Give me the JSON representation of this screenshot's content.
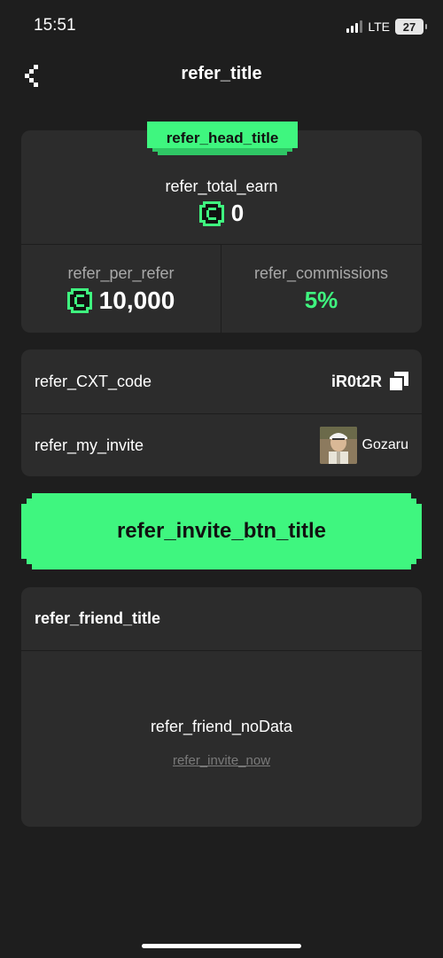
{
  "status_bar": {
    "time": "15:51",
    "network": "LTE",
    "battery": "27"
  },
  "header": {
    "title": "refer_title"
  },
  "earn_card": {
    "head_title": "refer_head_title",
    "total_earn_label": "refer_total_earn",
    "total_earn_value": "0",
    "per_refer_label": "refer_per_refer",
    "per_refer_value": "10,000",
    "commissions_label": "refer_commissions",
    "commissions_value": "5%"
  },
  "code_card": {
    "code_label": "refer_CXT_code",
    "code_value": "iR0t2R",
    "my_invite_label": "refer_my_invite",
    "inviter_name": "Gozaru"
  },
  "invite_button": {
    "label": "refer_invite_btn_title"
  },
  "friends_card": {
    "title": "refer_friend_title",
    "no_data": "refer_friend_noData",
    "invite_now": "refer_invite_now"
  },
  "colors": {
    "accent": "#3ff67f",
    "background": "#1e1e1e",
    "card": "#2c2c2c"
  }
}
